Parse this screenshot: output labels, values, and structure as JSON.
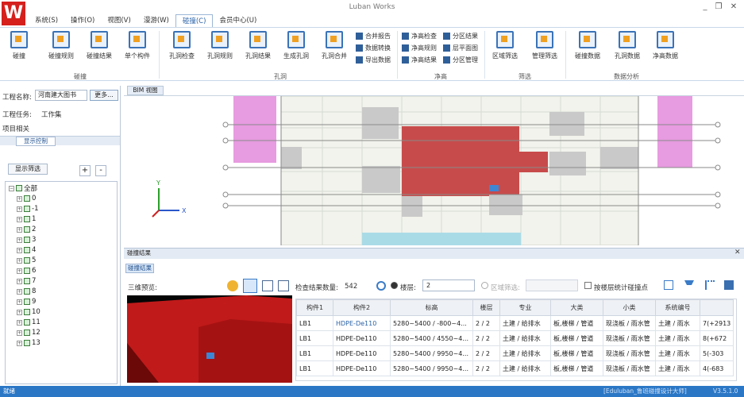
{
  "app": {
    "title": "Luban Works",
    "win_min": "_",
    "win_max": "❐",
    "win_close": "✕"
  },
  "menu": [
    "系统(S)",
    "操作(O)",
    "视图(V)",
    "漫游(W)",
    "碰撞(C)",
    "会员中心(U)"
  ],
  "ribbon": {
    "buttons": [
      "碰撞",
      "碰撞规则",
      "碰撞结果",
      "单个构件",
      "孔洞检查",
      "孔洞规则",
      "孔洞结果",
      "生成孔洞",
      "孔洞合并",
      "区域筛选",
      "管理筛选",
      "碰撞数据",
      "孔洞数据",
      "净高数据"
    ],
    "small": [
      "合并报告",
      "数据转换",
      "导出数据",
      "净高检查",
      "净高规则",
      "净高结果",
      "分区结果",
      "层平面图",
      "分区管理"
    ],
    "groups": [
      "碰撞",
      "孔洞",
      "净高",
      "筛选",
      "数据分析"
    ]
  },
  "left": {
    "project_label": "工程名称:",
    "project_value": "河南建大图书",
    "more_btn": "更多...",
    "task_label": "工程任务:",
    "task_value": "工作集",
    "project_related": "项目相关",
    "tab": "显示控制",
    "filter_btn": "显示筛选",
    "plus": "+",
    "minus": "-",
    "tree": [
      "全部",
      "0",
      "-1",
      "1",
      "2",
      "3",
      "4",
      "5",
      "6",
      "7",
      "8",
      "9",
      "10",
      "11",
      "12",
      "13"
    ]
  },
  "viewport": {
    "tab": "BIM 视图",
    "axis_x": "X",
    "axis_y": "Y"
  },
  "panel": {
    "title": "碰撞结果",
    "tab": "碰撞结果",
    "preview_label": "三维预览:",
    "count_label": "检查结果数量:",
    "count_value": "542",
    "floor_label": "楼层:",
    "floor_value": "2",
    "region_label": "区域筛选:",
    "display_check": "按楼层统计碰撞点"
  },
  "table": {
    "headers": [
      "构件1",
      "构件2",
      "标高",
      "楼层",
      "专业",
      "大类",
      "小类",
      "系统编号"
    ],
    "rows": [
      [
        "LB1",
        "HDPE-De110",
        "5280~5400 / -800~4...",
        "2 / 2",
        "土建 / 给排水",
        "板,楼梯 / 管道",
        "现浇板 / 雨水管",
        "土建 / 雨水",
        "7(+2913"
      ],
      [
        "LB1",
        "HDPE-De110",
        "5280~5400 / 4550~4...",
        "2 / 2",
        "土建 / 给排水",
        "板,楼梯 / 管道",
        "现浇板 / 雨水管",
        "土建 / 雨水",
        "8(+672"
      ],
      [
        "LB1",
        "HDPE-De110",
        "5280~5400 / 9950~4...",
        "2 / 2",
        "土建 / 给排水",
        "板,楼梯 / 管道",
        "现浇板 / 雨水管",
        "土建 / 雨水",
        "5(-303"
      ],
      [
        "LB1",
        "HDPE-De110",
        "5280~5400 / 9950~4...",
        "2 / 2",
        "土建 / 给排水",
        "板,楼梯 / 管道",
        "现浇板 / 雨水管",
        "土建 / 雨水",
        "4(-683"
      ]
    ]
  },
  "status": {
    "left": "就绪",
    "right": "[Eduluban_鲁班碰撞设计大师]",
    "version": "V3.5.1.0"
  }
}
